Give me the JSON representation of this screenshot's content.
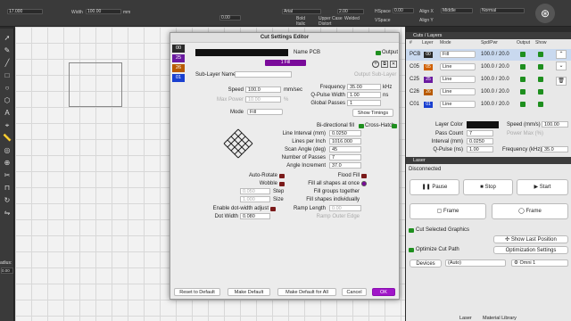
{
  "topbar": {
    "pos_x": "17.000",
    "width": "100.00",
    "rotate": "0.00",
    "font": "Arial",
    "height": "2.00",
    "hspace": "0.00",
    "align_x": "Middle",
    "style": "Normal",
    "bold": "Bold",
    "italic": "Italic",
    "upper": "Upper Case",
    "welded": "Welded",
    "distort": "Distort",
    "mm": "mm",
    "vspace_label": "VSpace",
    "hspace_label": "HSpace",
    "align_x_label": "Align X",
    "align_y_label": "Align Y"
  },
  "dialog": {
    "title": "Cut Settings Editor",
    "layers": [
      {
        "id": "00",
        "color": "#2a2a2a"
      },
      {
        "id": "25",
        "color": "#6a1aa0"
      },
      {
        "id": "26",
        "color": "#b85a00"
      },
      {
        "id": "01",
        "color": "#1a40d0"
      },
      {
        "id": "00",
        "color": "#1a1a1a"
      }
    ],
    "name_label": "Name PCB",
    "output_label": "Output",
    "mode_tag": "1 Fill",
    "sublayer_label": "Sub-Layer Name",
    "output_sublayer": "Output Sub-Layer",
    "speed_label": "Speed",
    "speed": "100.0",
    "speed_unit": "mm/sec",
    "maxpower_label": "Max Power",
    "maxpower": "10.00",
    "pct": "%",
    "freq_label": "Frequency",
    "freq": "35.00",
    "khz": "kHz",
    "qpulse_label": "Q-Pulse Width",
    "qpulse": "1.00",
    "ns": "ns",
    "passes_label": "Global Passes",
    "passes": "1",
    "mode_label": "Mode",
    "mode": "Fill",
    "show_timings": "Show Timings",
    "bidir": "Bi-directional fill",
    "crosshatch": "Cross-Hatch",
    "line_interval_label": "Line Interval (mm)",
    "line_interval": "0.0250",
    "lpi_label": "Lines per Inch",
    "lpi": "1016.000",
    "scan_angle_label": "Scan Angle (deg)",
    "scan_angle": "45",
    "num_passes_label": "Number of Passes",
    "num_passes": "7",
    "angle_inc_label": "Angle Increment",
    "angle_inc": "37.0",
    "autorotate": "Auto-Rotate",
    "floodfill": "Flood Fill",
    "wobble": "Wobble",
    "fill_all": "Fill all shapes at once",
    "step_label": "Step",
    "step": "0.050",
    "size_label": "Size",
    "size": "1.000",
    "fill_groups": "Fill groups together",
    "fill_individually": "Fill shapes individually",
    "dotwidth_adjust": "Enable dot-width adjust",
    "ramp_label": "Ramp Length",
    "ramp": "0.00",
    "dotwidth_label": "Dot Width",
    "dotwidth": "0.080",
    "ramp_outer": "Ramp Outer Edge",
    "reset": "Reset to Default",
    "make_default": "Make Default",
    "make_default_all": "Make Default for All",
    "cancel": "Cancel",
    "ok": "OK"
  },
  "cuts": {
    "title": "Cuts / Layers",
    "headers": [
      "#",
      "Layer",
      "Mode",
      "Spd/Pwr",
      "Output",
      "Show"
    ],
    "rows": [
      {
        "name": "PCB",
        "layer": "00",
        "color": "#2a2a2a",
        "mode": "Fill",
        "spd": "100.0 / 20.0"
      },
      {
        "name": "C05",
        "layer": "05",
        "color": "#d06000",
        "mode": "Line",
        "spd": "100.0 / 20.0"
      },
      {
        "name": "C25",
        "layer": "25",
        "color": "#6a1aa0",
        "mode": "Line",
        "spd": "100.0 / 20.0"
      },
      {
        "name": "C26",
        "layer": "26",
        "color": "#b85a00",
        "mode": "Line",
        "spd": "100.0 / 20.0"
      },
      {
        "name": "C01",
        "layer": "01",
        "color": "#1a40d0",
        "mode": "Line",
        "spd": "100.0 / 20.0"
      }
    ],
    "layer_color": "Layer Color",
    "speed_label": "Speed (mm/s)",
    "speed": "100.00",
    "pass_count": "Pass Count",
    "pass_val": "7",
    "power_label": "Power Max (%)",
    "interval_label": "Interval (mm)",
    "interval": "0.0250",
    "qpulse_label": "Q-Pulse (ns)",
    "qpulse": "1.00",
    "freq_label": "Frequency (kHz)",
    "freq": "35.0"
  },
  "laser": {
    "title": "Laser",
    "status": "Disconnected",
    "pause": "Pause",
    "stop": "Stop",
    "start": "Start",
    "frame1": "Frame",
    "frame2": "Frame",
    "cut_selected": "Cut Selected Graphics",
    "show_last": "Show Last Position",
    "optimize": "Optimize Cut Path",
    "opt_settings": "Optimization Settings",
    "devices": "Devices",
    "auto": "(Auto)",
    "omni": "Omni 1",
    "tab1": "Laser",
    "tab2": "Material Library"
  },
  "left": {
    "radius_label": "adius:",
    "radius": "0.00"
  }
}
